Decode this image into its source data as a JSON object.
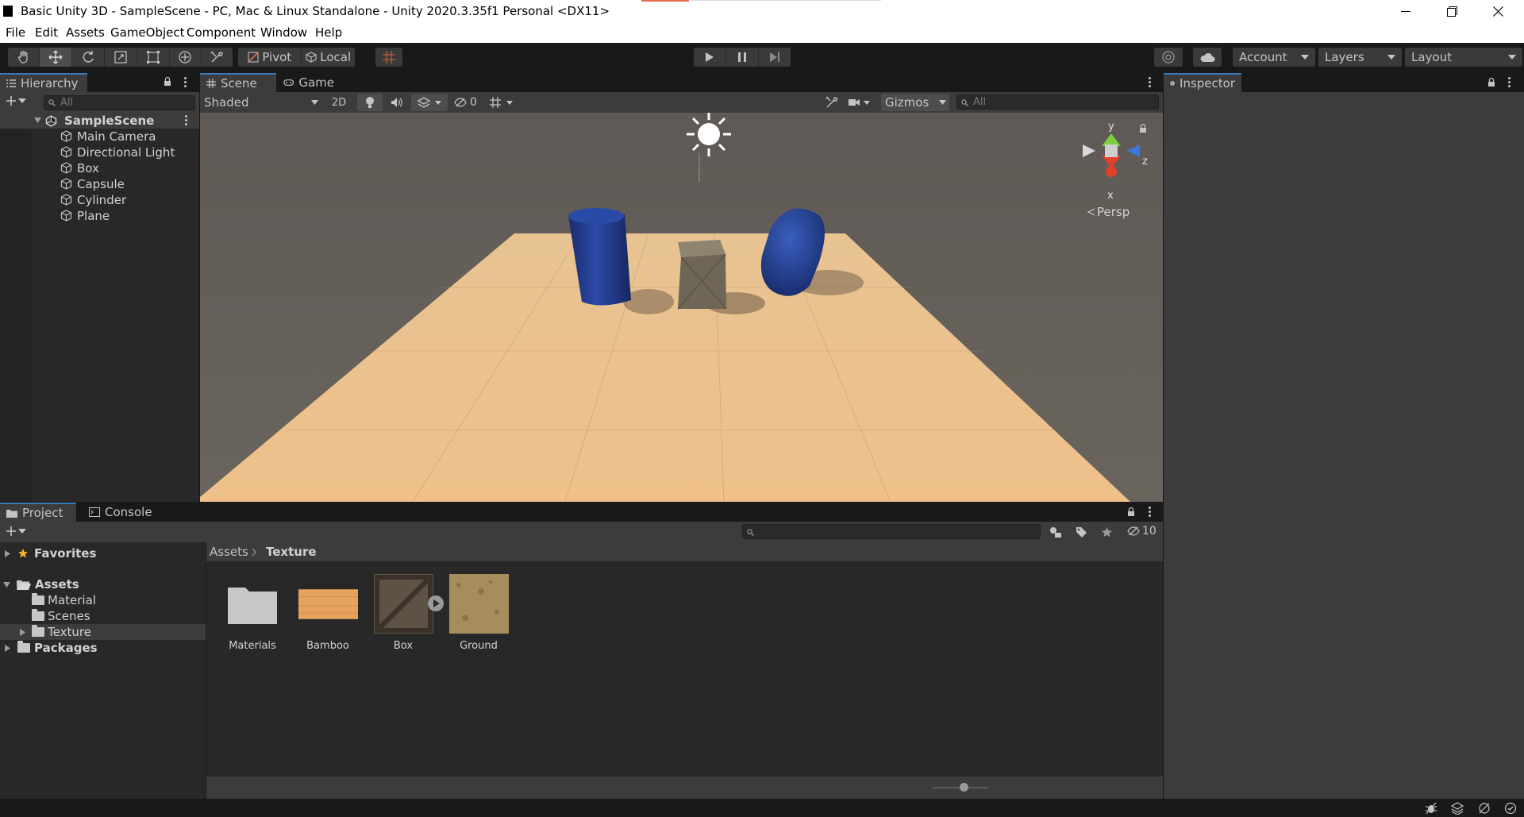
{
  "window": {
    "title": "Basic Unity 3D - SampleScene - PC, Mac & Linux Standalone - Unity 2020.3.35f1 Personal <DX11>"
  },
  "menu": [
    "File",
    "Edit",
    "Assets",
    "GameObject",
    "Component",
    "Window",
    "Help"
  ],
  "toolbar": {
    "pivot": "Pivot",
    "local": "Local",
    "account": "Account",
    "layers": "Layers",
    "layout": "Layout"
  },
  "hierarchy": {
    "tab": "Hierarchy",
    "search_placeholder": "All",
    "scene": "SampleScene",
    "objects": [
      "Main Camera",
      "Directional Light",
      "Box",
      "Capsule",
      "Cylinder",
      "Plane"
    ]
  },
  "scene_view": {
    "tabs": [
      "Scene",
      "Game"
    ],
    "shading": "Shaded",
    "mode_2d": "2D",
    "hidden_count": "0",
    "gizmos": "Gizmos",
    "search_placeholder": "All",
    "axes": {
      "y": "y",
      "x": "x",
      "z": "z"
    },
    "projection": "Persp"
  },
  "inspector": {
    "tab": "Inspector"
  },
  "project": {
    "tabs": [
      "Project",
      "Console"
    ],
    "tree": {
      "favorites": "Favorites",
      "assets": "Assets",
      "children": [
        "Material",
        "Scenes",
        "Texture"
      ],
      "packages": "Packages"
    },
    "breadcrumb": [
      "Assets",
      "Texture"
    ],
    "hidden_count": "10",
    "items": [
      "Materials",
      "Bamboo",
      "Box",
      "Ground"
    ]
  },
  "colors": {
    "selection": "#2c5d87",
    "tab_accent": "#3a79bb",
    "panel": "#282828",
    "floor": "#e9b97d",
    "blue_mesh": "#203a8a"
  }
}
